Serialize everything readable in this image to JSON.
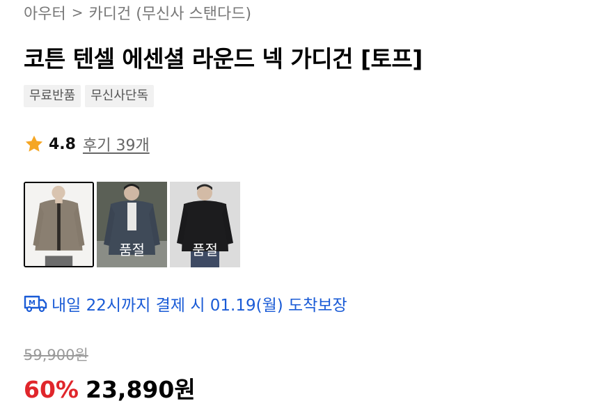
{
  "breadcrumb": {
    "category": "아우터",
    "separator": ">",
    "subcategory": "카디건 (무신사 스탠다드)"
  },
  "product": {
    "title": "코튼 텐셀 에센셜 라운드 넥 가디건 [토프]",
    "tags": [
      "무료반품",
      "무신사단독"
    ],
    "rating": "4.8",
    "reviews": "후기 39개"
  },
  "thumbnails": [
    {
      "color": "taupe",
      "selected": true,
      "status": ""
    },
    {
      "color": "charcoal",
      "selected": false,
      "status": "품절"
    },
    {
      "color": "black",
      "selected": false,
      "status": "품절"
    }
  ],
  "delivery": {
    "icon": "delivery-truck-icon",
    "text": "내일 22시까지 결제 시 01.19(월) 도착보장",
    "color": "#1a5bd6"
  },
  "price": {
    "original": "59,900원",
    "discount": "60%",
    "final": "23,890원",
    "discount_color": "#e0262b"
  },
  "colors": {
    "star": "#f5a623"
  }
}
